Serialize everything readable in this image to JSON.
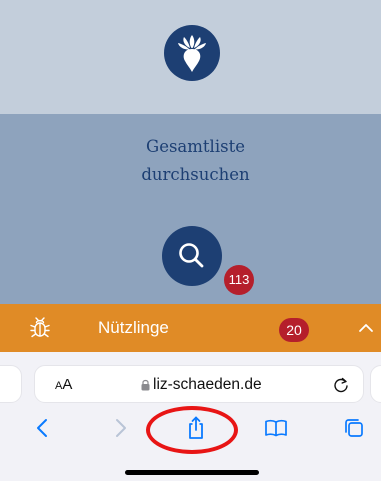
{
  "top_panel": {
    "logo_icon": "beet-icon"
  },
  "search_panel": {
    "title_line1": "Gesamtliste",
    "title_line2": "durchsuchen",
    "search_icon": "search-icon",
    "count": "113"
  },
  "category_bar": {
    "icon": "bug-icon",
    "label": "Nützlinge",
    "count": "20",
    "toggle_icon": "chevron-up-icon"
  },
  "browser": {
    "text_size_label_small": "A",
    "text_size_label_large": "A",
    "domain": "liz-schaeden.de",
    "toolbar": [
      "back-icon",
      "forward-icon",
      "share-icon",
      "bookmarks-icon",
      "tabs-icon"
    ]
  },
  "colors": {
    "top_panel": "#c3cedb",
    "search_panel": "#8ea3bd",
    "brand_blue": "#1d3f73",
    "badge_red": "#b51f2b",
    "category_orange": "#e08b26",
    "ios_blue": "#0a7aff",
    "annotation": "#e81515"
  }
}
